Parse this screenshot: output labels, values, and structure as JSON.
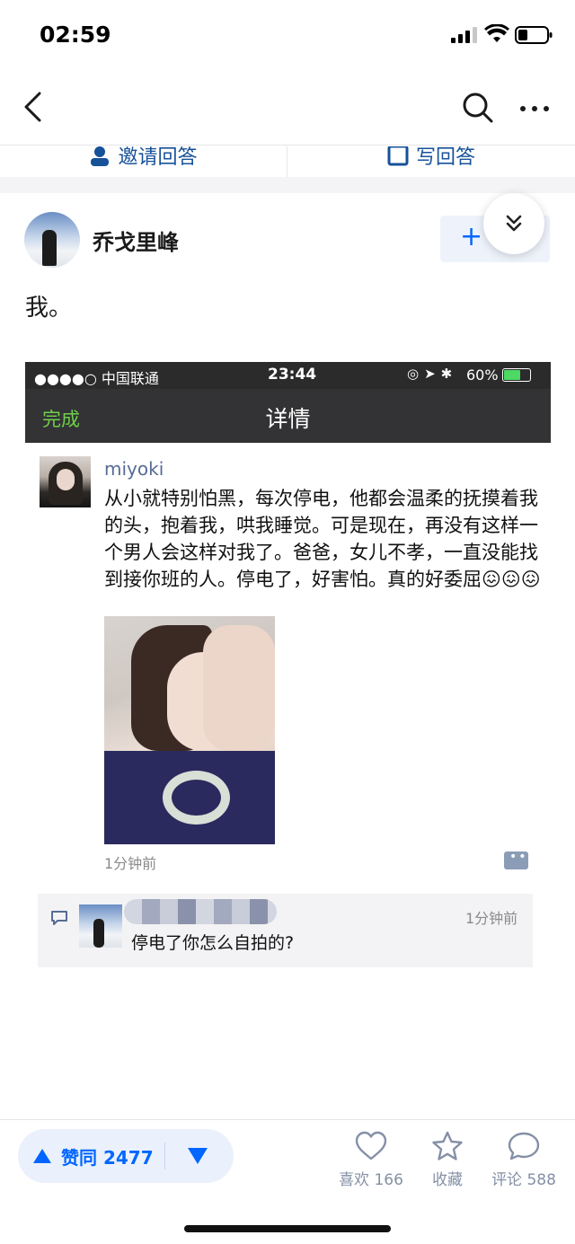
{
  "status_bar": {
    "time": "02:59"
  },
  "answer_bar": {
    "invite_label": "邀请回答",
    "write_label": "写回答"
  },
  "author": {
    "name": "乔戈里峰",
    "follow_label": "+"
  },
  "answer": {
    "text": "我。"
  },
  "embedded": {
    "status": {
      "carrier": "●●●●○ 中国联通",
      "time": "23:44",
      "battery": "60%"
    },
    "nav": {
      "done_label": "完成",
      "title": "详情"
    },
    "post": {
      "author": "miyoki",
      "text": "从小就特别怕黑，每次停电，他都会温柔的抚摸着我的头，抱着我，哄我睡觉。可是现在，再没有这样一个男人会这样对我了。爸爸，女儿不孝，一直没能找到接你班的人。停电了，好害怕。真的好委屈😖😖😖",
      "time": "1分钟前"
    },
    "reply": {
      "time": "1分钟前",
      "text": "停电了你怎么自拍的?"
    }
  },
  "bottom_bar": {
    "upvote_label": "赞同 2477",
    "like_label": "喜欢 166",
    "collect_label": "收藏",
    "comment_label": "评论 588"
  },
  "colors": {
    "accent": "#0066ff",
    "wechat_green": "#6fd04b",
    "link_blue": "#576b95",
    "muted": "#8590a6"
  }
}
